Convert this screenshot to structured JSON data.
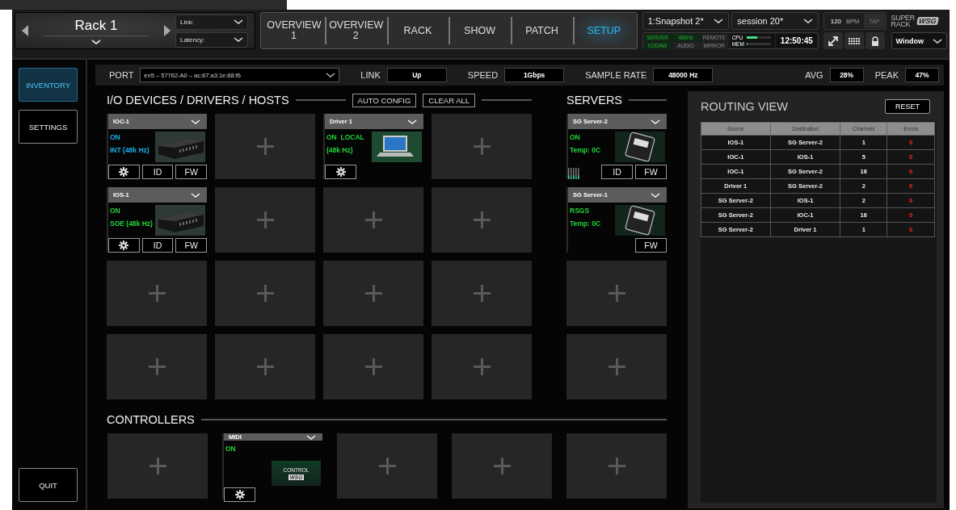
{
  "header": {
    "rack": {
      "title": "Rack 1"
    },
    "link_dropdown": {
      "label": "Link:"
    },
    "latency_dropdown": {
      "label": "Latency:"
    },
    "nav_tabs": [
      {
        "label": "OVERVIEW 1",
        "selected": false
      },
      {
        "label": "OVERVIEW 2",
        "selected": false
      },
      {
        "label": "RACK",
        "selected": false
      },
      {
        "label": "SHOW",
        "selected": false
      },
      {
        "label": "PATCH",
        "selected": false
      },
      {
        "label": "SETUP",
        "selected": true
      }
    ],
    "snapshot_dropdown": {
      "value": "1:Snapshot 2*"
    },
    "session_dropdown": {
      "value": "session 20*"
    },
    "status_indicators": [
      {
        "label": "SERVER",
        "active": true
      },
      {
        "label": "48kHz",
        "active": true
      },
      {
        "label": "REMOTE",
        "active": false
      },
      {
        "label": "IO/DAW",
        "active": true
      },
      {
        "label": "AUDIO",
        "active": false
      },
      {
        "label": "MIRROR",
        "active": false
      }
    ],
    "meters": [
      {
        "label": "CPU",
        "level": 0.45
      },
      {
        "label": "MEM",
        "level": 0.05
      }
    ],
    "clock": "12:50:45",
    "tempo": {
      "value": "120",
      "unit": "BPM",
      "tap": "TAP"
    },
    "logo": {
      "line_1": "SUPER",
      "line_2": "RACK",
      "badge": "WSG"
    },
    "window_dropdown": {
      "value": "Window"
    }
  },
  "sidebar": {
    "items": [
      {
        "label": "INVENTORY",
        "selected": true
      },
      {
        "label": "SETTINGS",
        "selected": false
      }
    ],
    "quit": "QUIT"
  },
  "port_bar": {
    "port": {
      "label": "PORT",
      "value": "en5 – 57762-A0 – ac:87:a3:1e:88:f6"
    },
    "readouts": [
      {
        "label": "LINK",
        "value": "Up"
      },
      {
        "label": "SPEED",
        "value": "1Gbps"
      },
      {
        "label": "SAMPLE RATE",
        "value": "48000 Hz"
      }
    ],
    "load": [
      {
        "label": "AVG",
        "value": "28%"
      },
      {
        "label": "PEAK",
        "value": "47%"
      }
    ]
  },
  "io_devices": {
    "title": "I/O DEVICES / DRIVERS / HOSTS",
    "buttons": [
      "AUTO CONFIG",
      "CLEAR ALL"
    ],
    "slots": [
      {
        "kind": "interface",
        "name": "IOC-1",
        "status": [
          {
            "text": "ON",
            "color": "#1ab0e8"
          },
          {
            "text": "INT (48k Hz)",
            "color": "#1ab0e8"
          }
        ],
        "buttons": [
          {
            "kind": "gear"
          },
          {
            "kind": "text",
            "label": "ID"
          },
          {
            "kind": "text",
            "label": "FW"
          }
        ]
      },
      {
        "kind": "empty"
      },
      {
        "kind": "driver",
        "name": "Driver 1",
        "status": [
          {
            "text": "ON  LOCAL",
            "color": "#22d43c"
          },
          {
            "text": "(48k Hz)",
            "color": "#22d43c"
          }
        ],
        "buttons": [
          {
            "kind": "gear"
          }
        ]
      },
      {
        "kind": "empty"
      },
      {
        "kind": "interface",
        "name": "IOS-1",
        "status": [
          {
            "text": "ON",
            "color": "#22d43c"
          },
          {
            "text": "SOE (48k Hz)",
            "color": "#22d43c"
          }
        ],
        "buttons": [
          {
            "kind": "gear"
          },
          {
            "kind": "text",
            "label": "ID"
          },
          {
            "kind": "text",
            "label": "FW"
          }
        ]
      },
      {
        "kind": "empty"
      },
      {
        "kind": "empty"
      },
      {
        "kind": "empty"
      },
      {
        "kind": "empty"
      },
      {
        "kind": "empty"
      },
      {
        "kind": "empty"
      },
      {
        "kind": "empty"
      },
      {
        "kind": "empty"
      },
      {
        "kind": "empty"
      },
      {
        "kind": "empty"
      },
      {
        "kind": "empty"
      }
    ]
  },
  "servers": {
    "title": "SERVERS",
    "slots": [
      {
        "kind": "server",
        "name": "SG Server-2",
        "meter": true,
        "status": [
          {
            "text": "ON",
            "color": "#22d43c"
          },
          {
            "text": "Temp: 0C",
            "color": "#22d43c"
          }
        ],
        "buttons": [
          {
            "kind": "text",
            "label": "ID"
          },
          {
            "kind": "text",
            "label": "FW"
          }
        ]
      },
      {
        "kind": "server",
        "name": "SG Server-1",
        "meter": false,
        "status": [
          {
            "text": "RSGS",
            "color": "#22d43c"
          },
          {
            "text": "Temp: 0C",
            "color": "#22d43c"
          }
        ],
        "buttons": [
          {
            "kind": "text",
            "label": "FW"
          }
        ]
      },
      {
        "kind": "empty"
      },
      {
        "kind": "empty"
      }
    ]
  },
  "controllers": {
    "title": "CONTROLLERS",
    "slots": [
      {
        "kind": "empty"
      },
      {
        "kind": "controller",
        "name": "MIDI",
        "image_text": [
          "CONTROL",
          "WSG"
        ],
        "status": [
          {
            "text": "ON",
            "color": "#22d43c"
          }
        ],
        "buttons": [
          {
            "kind": "gear"
          }
        ]
      },
      {
        "kind": "empty"
      },
      {
        "kind": "empty"
      },
      {
        "kind": "empty"
      }
    ]
  },
  "routing_view": {
    "title": "ROUTING VIEW",
    "reset": "RESET",
    "columns": [
      "Source",
      "Destination",
      "Channels",
      "Errors"
    ],
    "rows": [
      [
        "IOS-1",
        "SG Server-2",
        "1",
        "0"
      ],
      [
        "IOC-1",
        "IOS-1",
        "5",
        "0"
      ],
      [
        "IOC-1",
        "SG Server-2",
        "16",
        "0"
      ],
      [
        "Driver 1",
        "SG Server-2",
        "2",
        "0"
      ],
      [
        "SG Server-2",
        "IOS-1",
        "2",
        "0"
      ],
      [
        "SG Server-2",
        "IOC-1",
        "16",
        "0"
      ],
      [
        "SG Server-2",
        "Driver 1",
        "1",
        "0"
      ]
    ]
  }
}
